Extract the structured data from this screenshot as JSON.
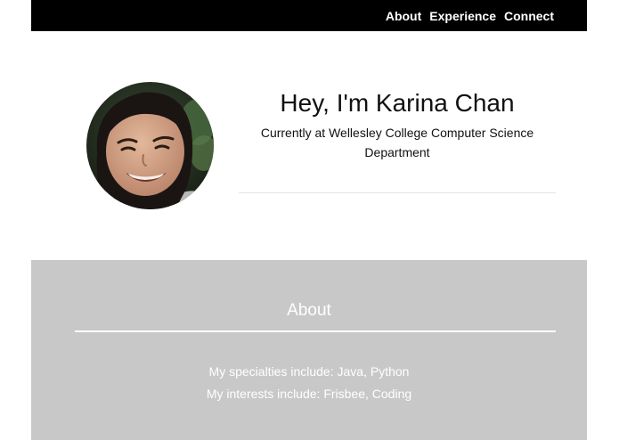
{
  "navbar": {
    "links": [
      {
        "label": "About"
      },
      {
        "label": "Experience"
      },
      {
        "label": "Connect"
      }
    ]
  },
  "hero": {
    "title": "Hey, I'm Karina Chan",
    "subtitle": "Currently at Wellesley College Computer Science Department",
    "avatar_icon": "profile-photo"
  },
  "about": {
    "heading": "About",
    "lines": [
      "My specialties include: Java, Python",
      "My interests include: Frisbee, Coding"
    ]
  },
  "colors": {
    "navbar_bg": "#000000",
    "about_bg": "#c8c8c8",
    "text_dark": "#111111",
    "text_light": "#ffffff"
  }
}
